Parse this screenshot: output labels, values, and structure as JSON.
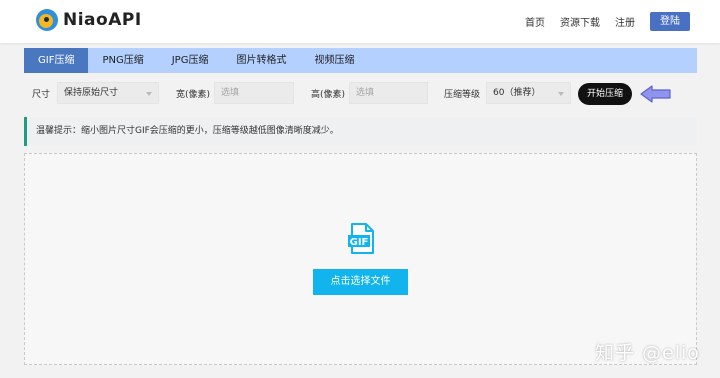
{
  "header": {
    "logo_text": "NiaoAPI",
    "nav": [
      "首页",
      "资源下载",
      "注册"
    ],
    "login_label": "登陆"
  },
  "tabs": [
    {
      "label": "GIF压缩",
      "active": true
    },
    {
      "label": "PNG压缩",
      "active": false
    },
    {
      "label": "JPG压缩",
      "active": false
    },
    {
      "label": "图片转格式",
      "active": false
    },
    {
      "label": "视频压缩",
      "active": false
    }
  ],
  "options": {
    "size_label": "尺寸",
    "size_value": "保持原始尺寸",
    "width_label": "宽(像素)",
    "width_placeholder": "选填",
    "height_label": "高(像素)",
    "height_placeholder": "选填",
    "level_label": "压缩等级",
    "level_value": "60（推荐）",
    "start_label": "开始压缩"
  },
  "tip": "温馨提示：缩小图片尺寸GIF会压缩的更小，压缩等级越低图像清晰度减少。",
  "dropzone": {
    "icon_text": "GIF",
    "choose_label": "点击选择文件"
  },
  "watermark": "知乎 @elio",
  "colors": {
    "tab_bar": "#b3d0ff",
    "tab_active": "#4a78c0",
    "login_bg": "#4a70c4",
    "choose_bg": "#12b4ee",
    "tip_accent": "#1f9e7f",
    "arrow": "#7b83e8"
  }
}
